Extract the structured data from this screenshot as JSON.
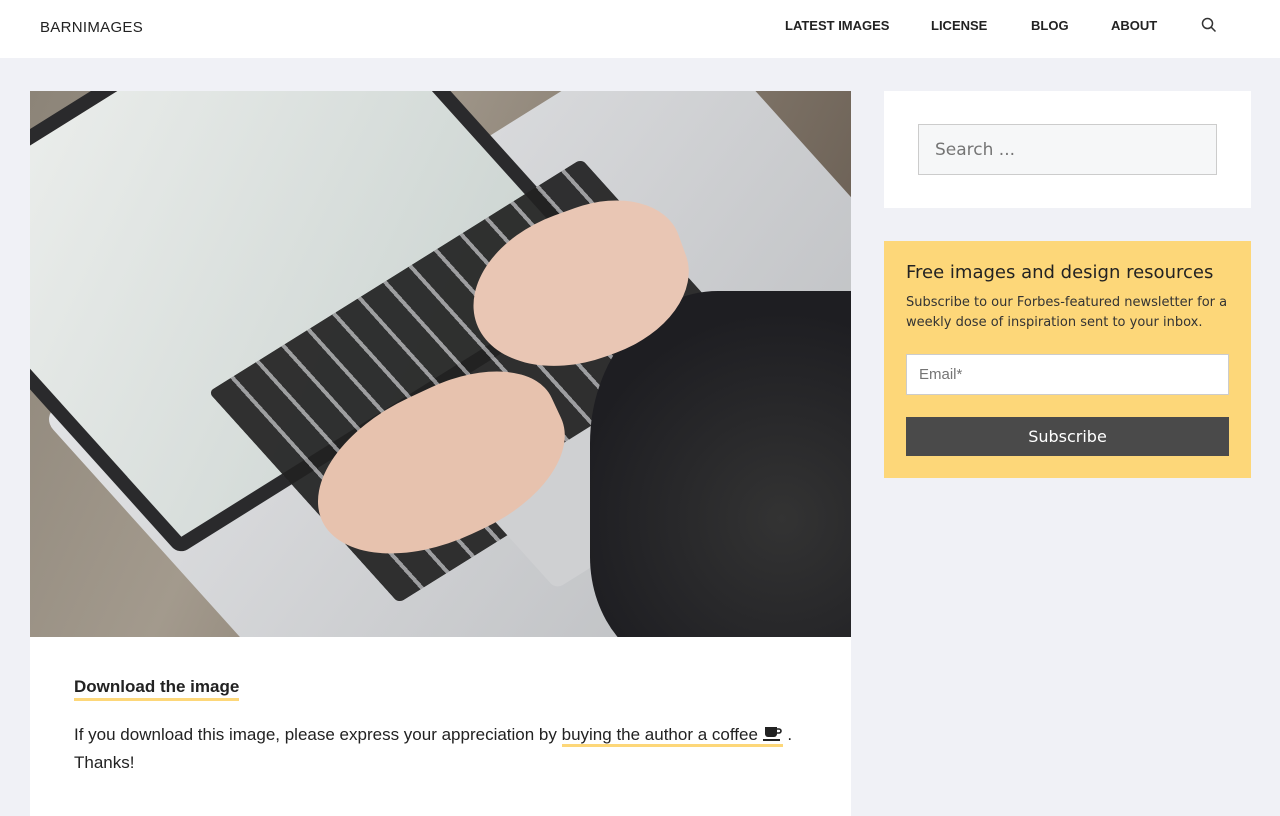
{
  "header": {
    "logo": "BARNIMAGES",
    "nav": [
      "LATEST IMAGES",
      "LICENSE",
      "BLOG",
      "ABOUT"
    ]
  },
  "photo": {
    "description_icon": "laptop-photo"
  },
  "content": {
    "download_title": "Download the image",
    "para_before": "If you download this image, please express your appreciation by ",
    "coffee_link": "buying the author a coffee",
    "para_after": ". Thanks!"
  },
  "sidebar": {
    "search_placeholder": "Search ...",
    "newsletter": {
      "title": "Free images and design resources",
      "text": "Subscribe to our Forbes-featured newsletter for a weekly dose of inspiration sent to your inbox.",
      "email_placeholder": "Email*",
      "button": "Subscribe"
    }
  },
  "colors": {
    "accent": "#fdd779",
    "background": "#f0f1f6",
    "button": "#4a4a4a"
  }
}
